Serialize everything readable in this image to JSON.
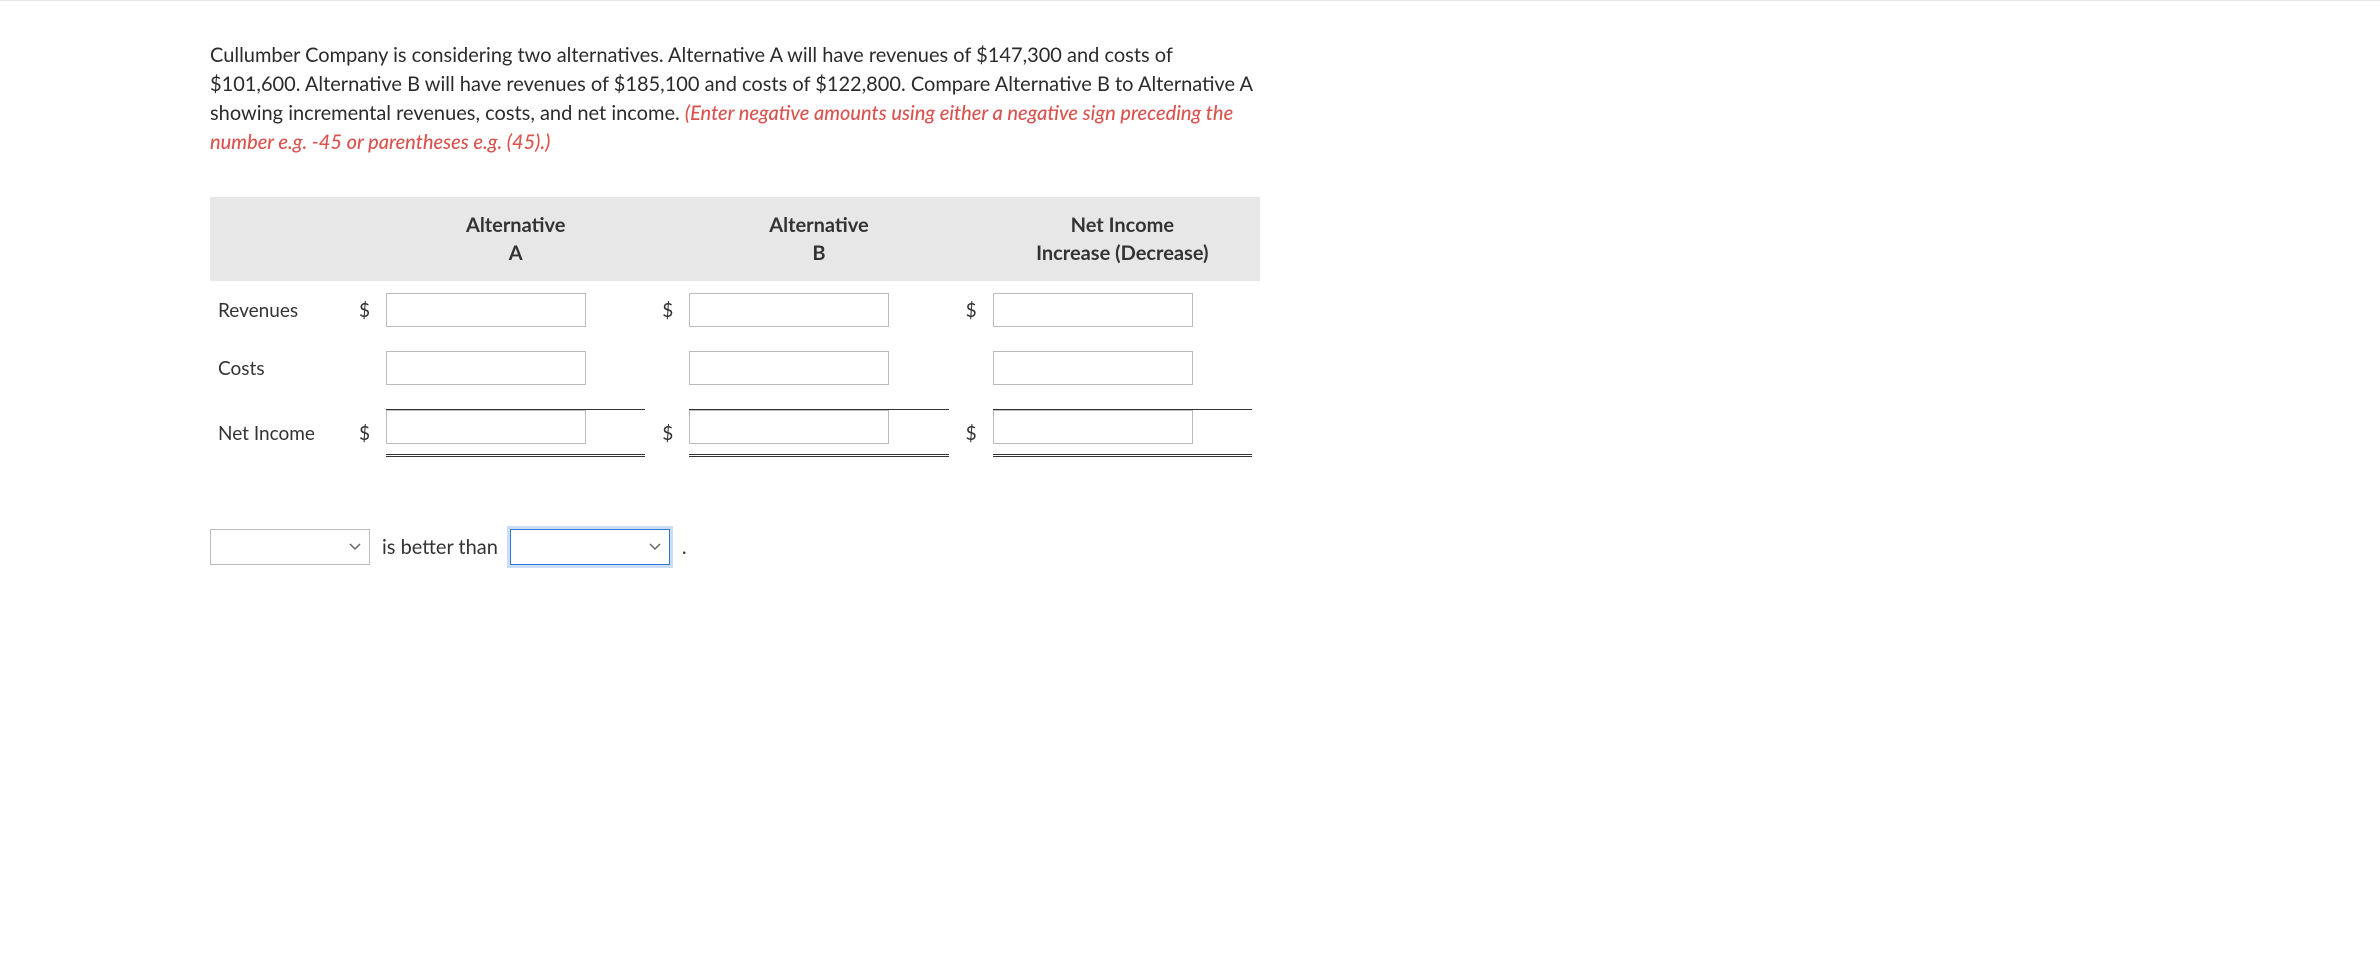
{
  "question": {
    "body": "Cullumber Company is considering two alternatives. Alternative A will have revenues of $147,300 and costs of $101,600. Alternative B will have revenues of $185,100 and costs of $122,800. Compare Alternative B to Alternative A showing incremental revenues, costs, and net income. ",
    "hint": "(Enter negative amounts using either a negative sign preceding the number e.g. -45 or parentheses e.g. (45).)"
  },
  "table": {
    "headers": {
      "col1": "Alternative\nA",
      "col2": "Alternative\nB",
      "col3": "Net Income\nIncrease (Decrease)"
    },
    "rows": {
      "revenues": {
        "label": "Revenues",
        "currency": "$",
        "a": "",
        "b": "",
        "c": ""
      },
      "costs": {
        "label": "Costs",
        "currency": "",
        "a": "",
        "b": "",
        "c": ""
      },
      "net": {
        "label": "Net Income",
        "currency": "$",
        "a": "",
        "b": "",
        "c": ""
      }
    }
  },
  "sentence": {
    "left_value": "",
    "middle_text": "is better than",
    "right_value": "",
    "period": "."
  }
}
